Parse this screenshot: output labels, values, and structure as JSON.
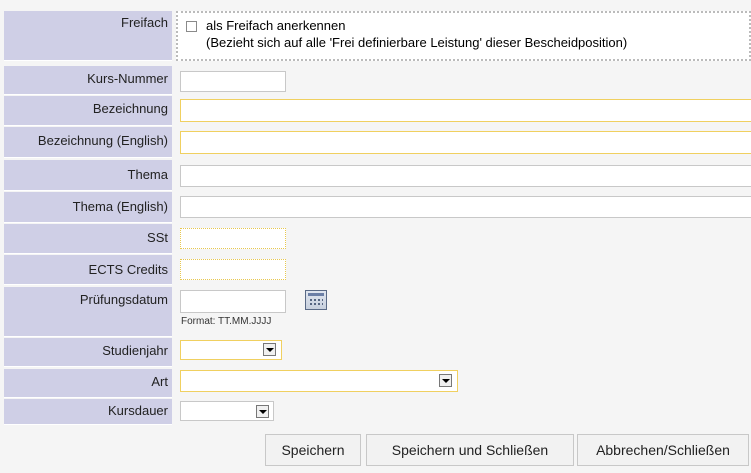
{
  "fields": {
    "freifach": {
      "label": "Freifach",
      "checkbox_label": "als Freifach anerkennen",
      "checkbox_note": "(Bezieht sich auf alle 'Frei definierbare Leistung' dieser Bescheidposition)",
      "checked": false
    },
    "kursnummer": {
      "label": "Kurs-Nummer",
      "value": ""
    },
    "bezeichnung": {
      "label": "Bezeichnung",
      "value": ""
    },
    "bezeichnung_en": {
      "label": "Bezeichnung (English)",
      "value": ""
    },
    "thema": {
      "label": "Thema",
      "value": ""
    },
    "thema_en": {
      "label": "Thema (English)",
      "value": ""
    },
    "sst": {
      "label": "SSt",
      "value": ""
    },
    "ects": {
      "label": "ECTS Credits",
      "value": ""
    },
    "pruefungsdatum": {
      "label": "Prüfungsdatum",
      "value": "",
      "format_hint": "Format: TT.MM.JJJJ"
    },
    "studienjahr": {
      "label": "Studienjahr",
      "selected": ""
    },
    "art": {
      "label": "Art",
      "selected": ""
    },
    "kursdauer": {
      "label": "Kursdauer",
      "selected": ""
    }
  },
  "buttons": {
    "save": "Speichern",
    "save_close": "Speichern und Schließen",
    "cancel_close": "Abbrechen/Schließen"
  },
  "icons": {
    "calendar": "calendar-icon",
    "dropdown": "chevron-down-icon"
  },
  "colors": {
    "label_bg": "#cfcfe6",
    "required_border": "#f0d060"
  }
}
